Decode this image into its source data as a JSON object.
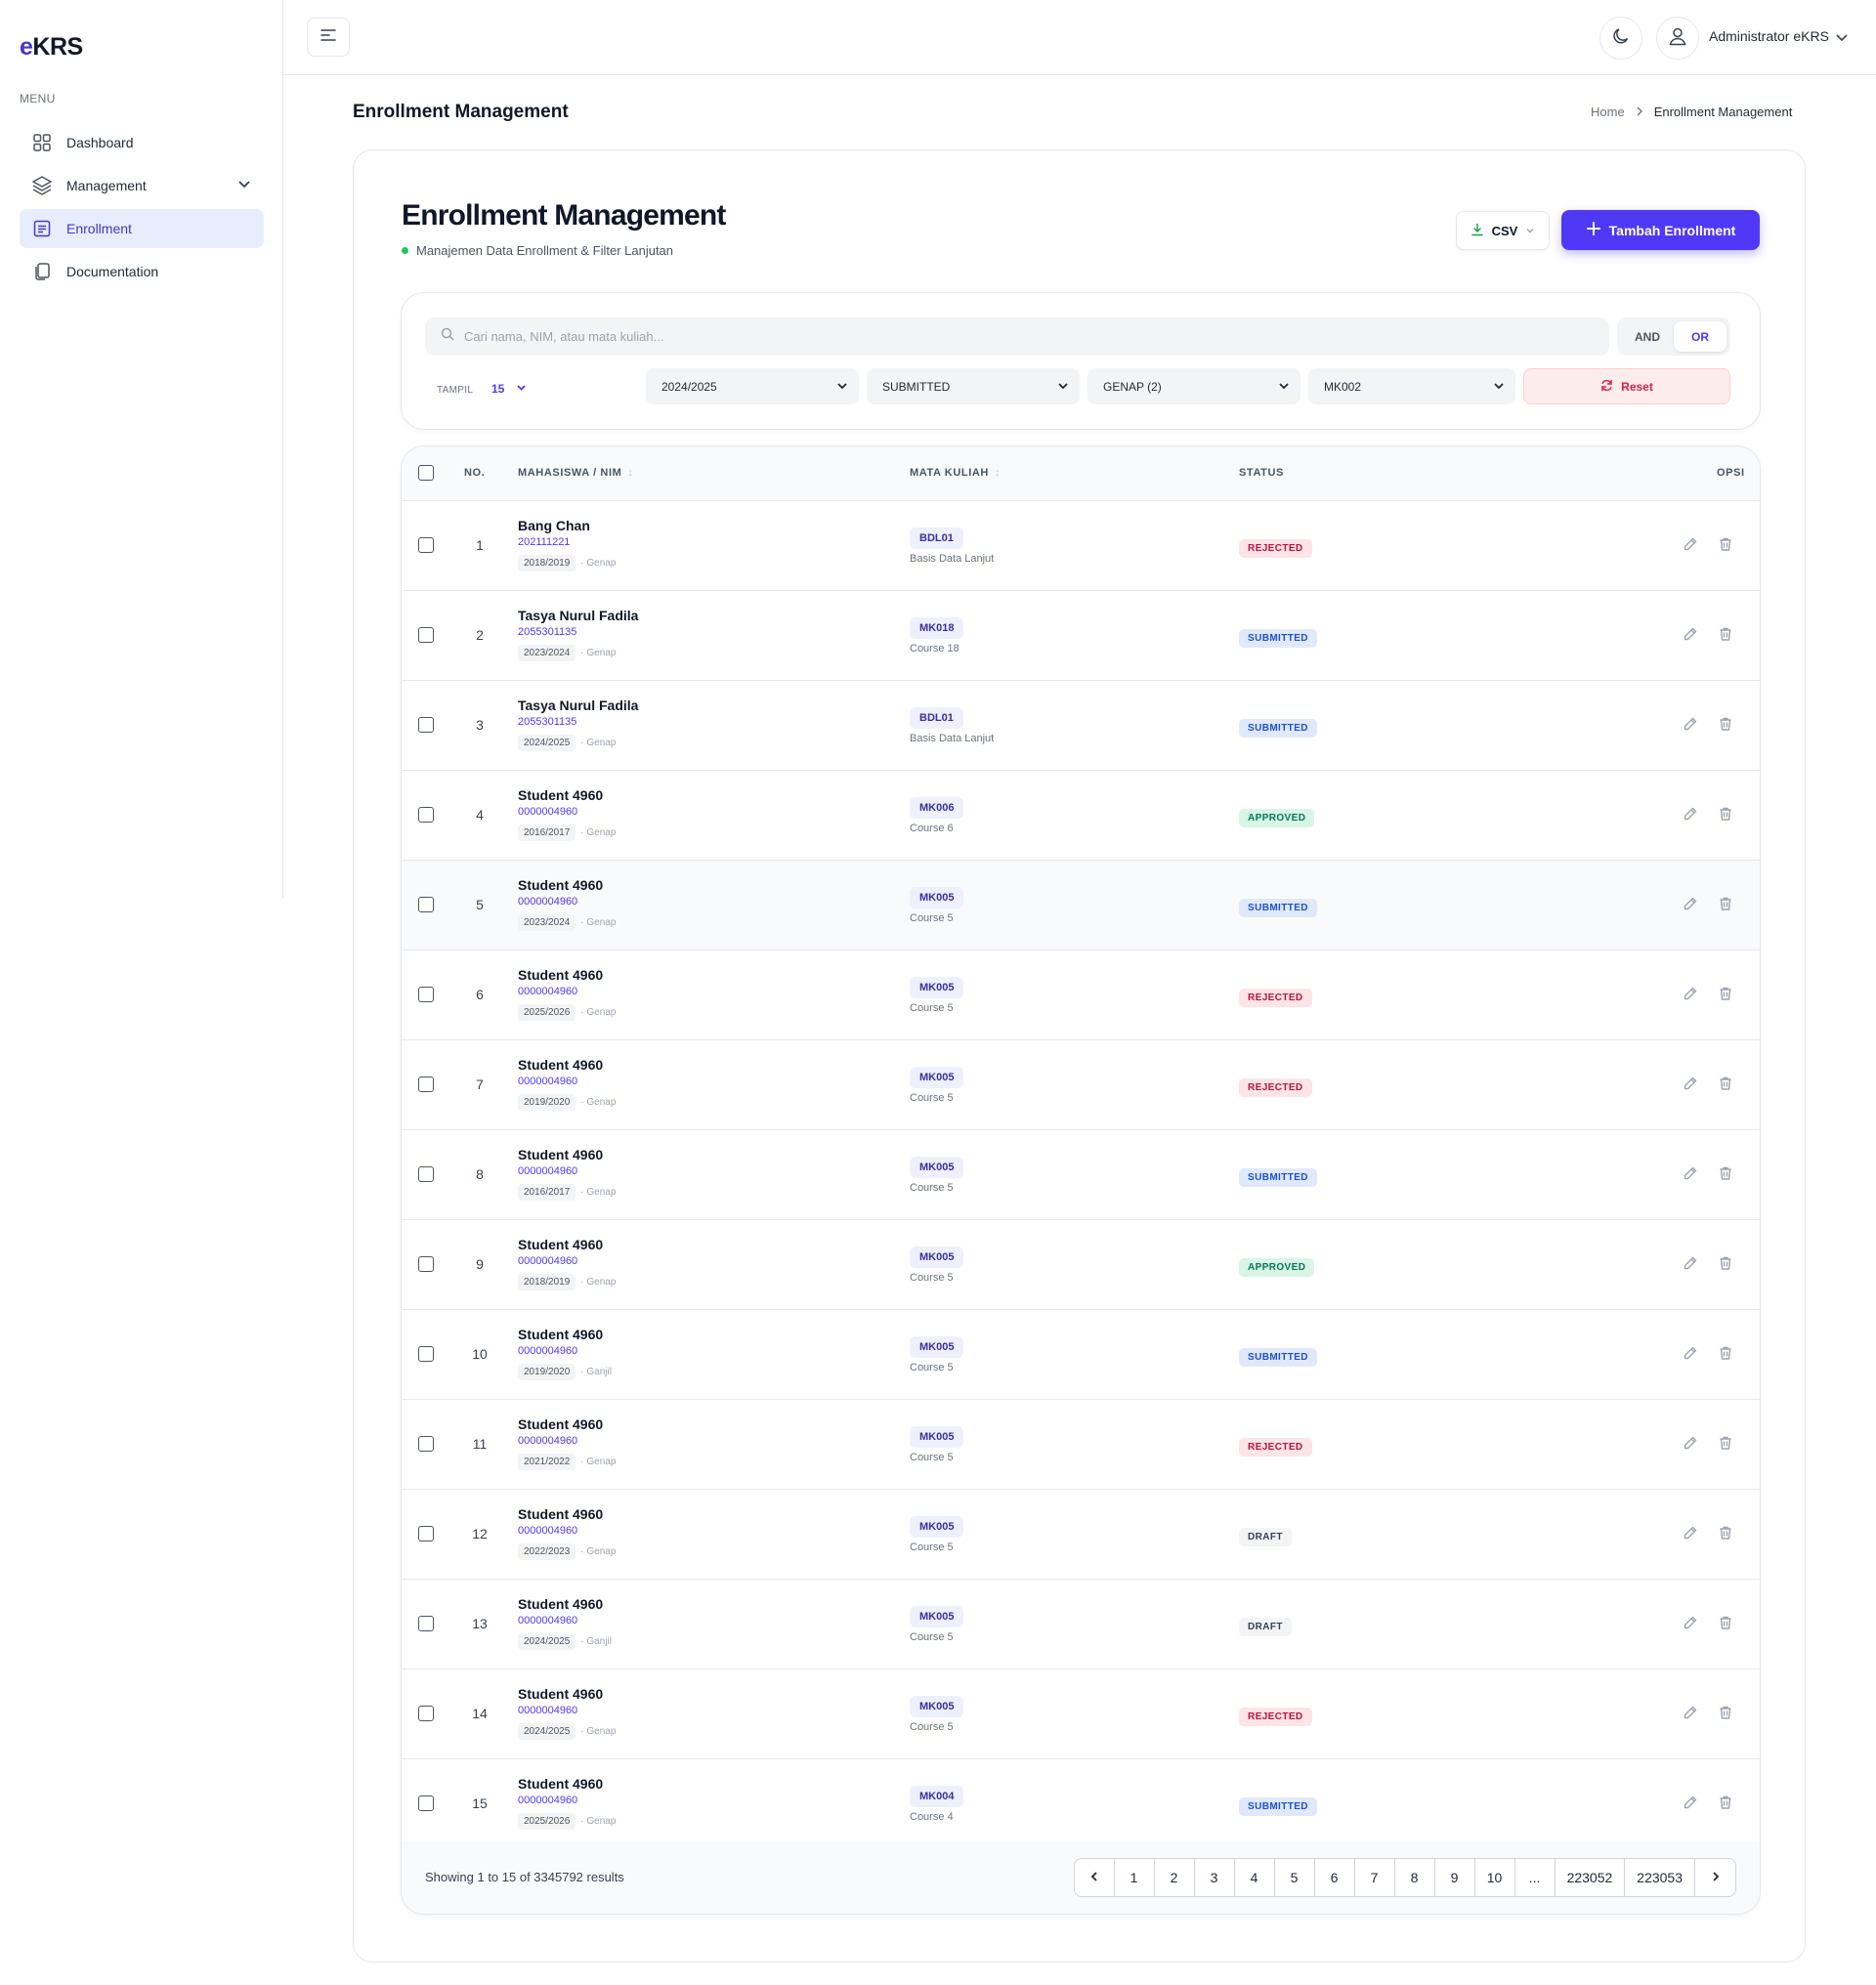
{
  "app": {
    "logo_prefix": "e",
    "logo_rest": "KRS",
    "menu_label": "MENU"
  },
  "sidebar": {
    "items": [
      {
        "label": "Dashboard",
        "icon": "grid-icon"
      },
      {
        "label": "Management",
        "icon": "layers-icon"
      },
      {
        "label": "Enrollment",
        "icon": "list-icon",
        "active": true
      },
      {
        "label": "Documentation",
        "icon": "docs-icon"
      }
    ]
  },
  "header": {
    "user_name": "Administrator eKRS"
  },
  "page": {
    "title": "Enrollment Management",
    "breadcrumb": {
      "home": "Home",
      "current": "Enrollment Management"
    }
  },
  "card": {
    "title": "Enrollment Management",
    "subtitle": "Manajemen Data Enrollment & Filter Lanjutan",
    "csv_label": "CSV",
    "add_label": "Tambah Enrollment"
  },
  "filters": {
    "search_placeholder": "Cari nama, NIM, atau mata kuliah...",
    "and_label": "AND",
    "or_label": "OR",
    "tampil_label": "TAMPIL",
    "tampil_value": "15",
    "year": "2024/2025",
    "status": "SUBMITTED",
    "semester": "GENAP (2)",
    "course": "MK002",
    "reset_label": "Reset"
  },
  "table": {
    "headers": {
      "no": "NO.",
      "student": "MAHASISWA / NIM",
      "course": "MATA KULIAH",
      "status": "STATUS",
      "options": "OPSI"
    },
    "rows": [
      {
        "no": "1",
        "name": "Bang Chan",
        "nim": "202111221",
        "year": "2018/2019",
        "sem": "· Genap",
        "code": "BDL01",
        "course": "Basis Data Lanjut",
        "status": "REJECTED"
      },
      {
        "no": "2",
        "name": "Tasya Nurul Fadila",
        "nim": "2055301135",
        "year": "2023/2024",
        "sem": "· Genap",
        "code": "MK018",
        "course": "Course 18",
        "status": "SUBMITTED"
      },
      {
        "no": "3",
        "name": "Tasya Nurul Fadila",
        "nim": "2055301135",
        "year": "2024/2025",
        "sem": "· Genap",
        "code": "BDL01",
        "course": "Basis Data Lanjut",
        "status": "SUBMITTED"
      },
      {
        "no": "4",
        "name": "Student 4960",
        "nim": "0000004960",
        "year": "2016/2017",
        "sem": "· Genap",
        "code": "MK006",
        "course": "Course 6",
        "status": "APPROVED"
      },
      {
        "no": "5",
        "name": "Student 4960",
        "nim": "0000004960",
        "year": "2023/2024",
        "sem": "· Genap",
        "code": "MK005",
        "course": "Course 5",
        "status": "SUBMITTED"
      },
      {
        "no": "6",
        "name": "Student 4960",
        "nim": "0000004960",
        "year": "2025/2026",
        "sem": "· Genap",
        "code": "MK005",
        "course": "Course 5",
        "status": "REJECTED"
      },
      {
        "no": "7",
        "name": "Student 4960",
        "nim": "0000004960",
        "year": "2019/2020",
        "sem": "· Genap",
        "code": "MK005",
        "course": "Course 5",
        "status": "REJECTED"
      },
      {
        "no": "8",
        "name": "Student 4960",
        "nim": "0000004960",
        "year": "2016/2017",
        "sem": "· Genap",
        "code": "MK005",
        "course": "Course 5",
        "status": "SUBMITTED"
      },
      {
        "no": "9",
        "name": "Student 4960",
        "nim": "0000004960",
        "year": "2018/2019",
        "sem": "· Genap",
        "code": "MK005",
        "course": "Course 5",
        "status": "APPROVED"
      },
      {
        "no": "10",
        "name": "Student 4960",
        "nim": "0000004960",
        "year": "2019/2020",
        "sem": "· Ganjil",
        "code": "MK005",
        "course": "Course 5",
        "status": "SUBMITTED"
      },
      {
        "no": "11",
        "name": "Student 4960",
        "nim": "0000004960",
        "year": "2021/2022",
        "sem": "· Genap",
        "code": "MK005",
        "course": "Course 5",
        "status": "REJECTED"
      },
      {
        "no": "12",
        "name": "Student 4960",
        "nim": "0000004960",
        "year": "2022/2023",
        "sem": "· Genap",
        "code": "MK005",
        "course": "Course 5",
        "status": "DRAFT"
      },
      {
        "no": "13",
        "name": "Student 4960",
        "nim": "0000004960",
        "year": "2024/2025",
        "sem": "· Ganjil",
        "code": "MK005",
        "course": "Course 5",
        "status": "DRAFT"
      },
      {
        "no": "14",
        "name": "Student 4960",
        "nim": "0000004960",
        "year": "2024/2025",
        "sem": "· Genap",
        "code": "MK005",
        "course": "Course 5",
        "status": "REJECTED"
      },
      {
        "no": "15",
        "name": "Student 4960",
        "nim": "0000004960",
        "year": "2025/2026",
        "sem": "· Genap",
        "code": "MK004",
        "course": "Course 4",
        "status": "SUBMITTED"
      }
    ]
  },
  "footer": {
    "showing": "Showing 1 to 15 of 3345792 results",
    "pages": [
      "1",
      "2",
      "3",
      "4",
      "5",
      "6",
      "7",
      "8",
      "9",
      "10",
      "...",
      "223052",
      "223053"
    ]
  },
  "colors": {
    "accent": "#4f39f6",
    "active_nav_bg": "#e8edfd"
  }
}
